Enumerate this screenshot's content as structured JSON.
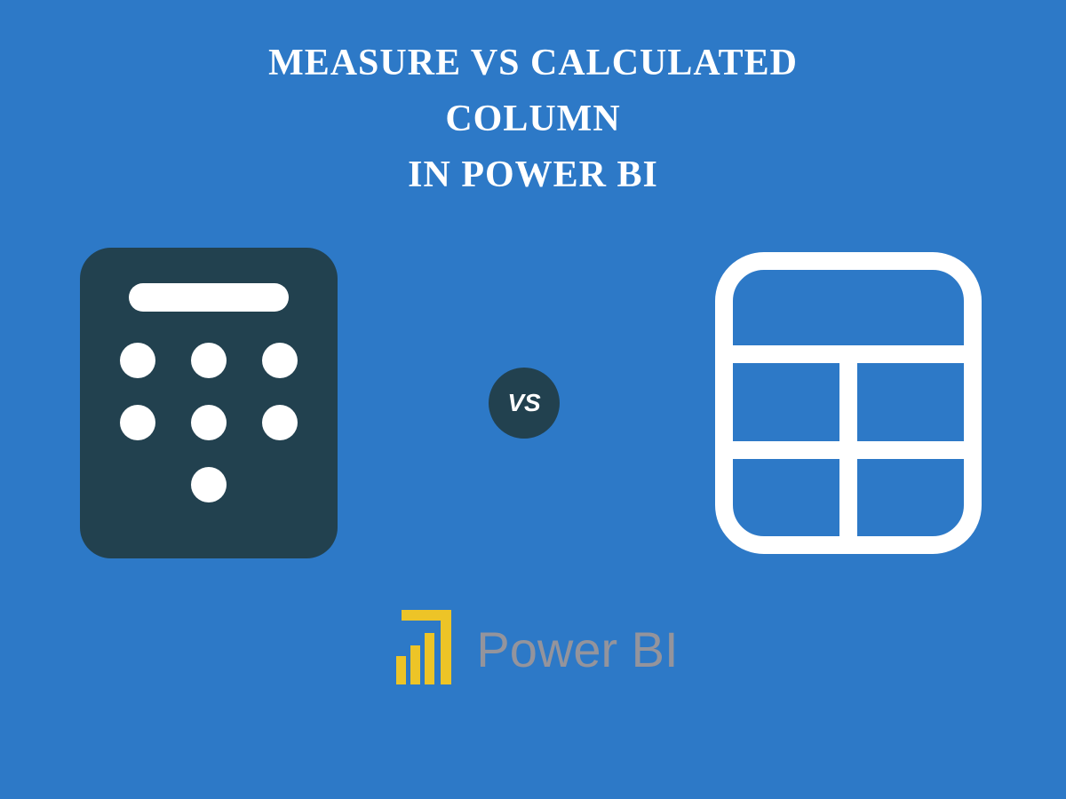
{
  "title": {
    "line1": "MEASURE VS CALCULATED",
    "line2": "COLUMN",
    "line3": "IN  POWER BI"
  },
  "vs_label": "VS",
  "logo_text": "Power BI",
  "colors": {
    "background": "#2d79c7",
    "dark_accent": "#22414f",
    "white": "#ffffff",
    "logo_yellow": "#edc427",
    "logo_text": "#94949c"
  }
}
